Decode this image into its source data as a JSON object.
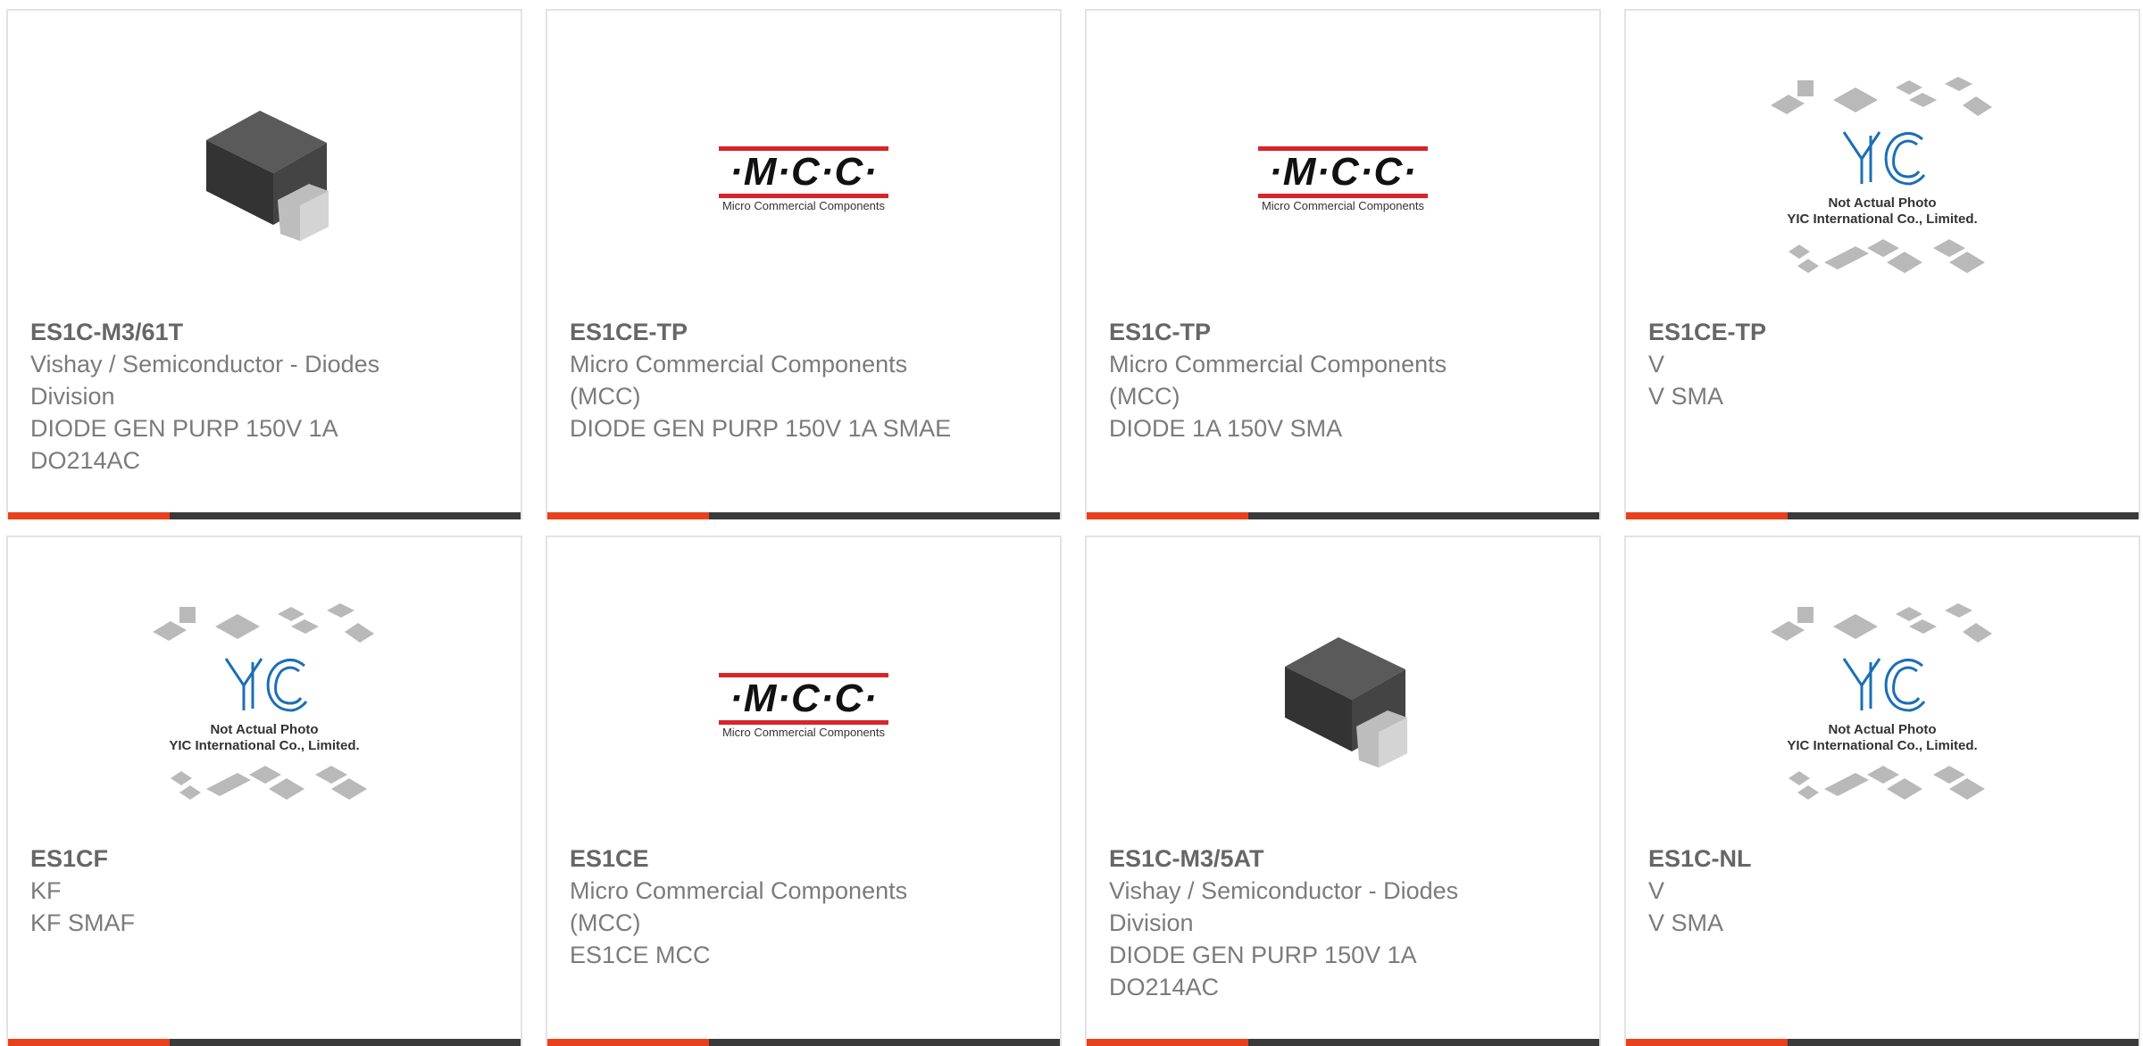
{
  "cards": [
    {
      "part_number": "ES1C-M3/61T",
      "manufacturer": "Vishay / Semiconductor - Diodes Division",
      "description": "DIODE GEN PURP 150V 1A DO214AC",
      "image": "diode-package-photo"
    },
    {
      "part_number": "ES1CE-TP",
      "manufacturer": "Micro Commercial Components (MCC)",
      "description": "DIODE GEN PURP 150V 1A SMAE",
      "image": "mcc-logo"
    },
    {
      "part_number": "ES1C-TP",
      "manufacturer": "Micro Commercial Components (MCC)",
      "description": "DIODE 1A 150V SMA",
      "image": "mcc-logo"
    },
    {
      "part_number": "ES1CE-TP",
      "manufacturer": "V",
      "description": "V SMA",
      "image": "yic-placeholder"
    },
    {
      "part_number": "ES1CF",
      "manufacturer": "KF",
      "description": "KF SMAF",
      "image": "yic-placeholder"
    },
    {
      "part_number": "ES1CE",
      "manufacturer": "Micro Commercial Components (MCC)",
      "description": "ES1CE MCC",
      "image": "mcc-logo"
    },
    {
      "part_number": "ES1C-M3/5AT",
      "manufacturer": "Vishay / Semiconductor - Diodes Division",
      "description": "DIODE GEN PURP 150V 1A DO214AC",
      "image": "diode-package-photo"
    },
    {
      "part_number": "ES1C-NL",
      "manufacturer": "V",
      "description": "V SMA",
      "image": "yic-placeholder"
    }
  ],
  "mcc_logo": {
    "letters": "·M·C·C·",
    "tagline": "Micro Commercial Components"
  },
  "yic_placeholder": {
    "line1": "Not Actual Photo",
    "line2": "YIC International Co., Limited."
  },
  "colors": {
    "accent": "#e8401c",
    "bar": "#3a3a3a",
    "mcc_red": "#d8252a",
    "yic_blue": "#1b6fb5"
  }
}
